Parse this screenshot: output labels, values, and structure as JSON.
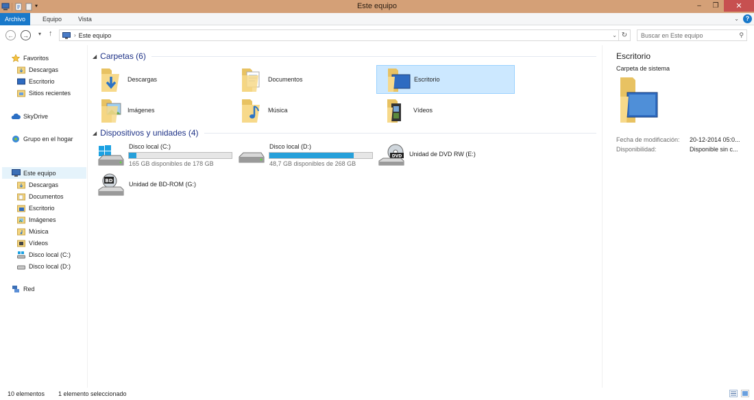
{
  "window": {
    "title": "Este equipo",
    "controls": {
      "minimize": "–",
      "maximize": "❐",
      "close": "✕"
    }
  },
  "ribbon": {
    "tabs": [
      {
        "label": "Archivo"
      },
      {
        "label": "Equipo"
      },
      {
        "label": "Vista"
      }
    ],
    "help_label": "?"
  },
  "address_bar": {
    "back_icon": "back-arrow-icon",
    "forward_icon": "forward-arrow-icon",
    "up_icon": "up-arrow-icon",
    "breadcrumb": [
      "Este equipo"
    ]
  },
  "search": {
    "placeholder": "Buscar en Este equipo",
    "value": ""
  },
  "nav_pane": {
    "favorites": {
      "label": "Favoritos",
      "items": [
        {
          "label": "Descargas",
          "icon": "downloads-folder-icon"
        },
        {
          "label": "Escritorio",
          "icon": "desktop-icon"
        },
        {
          "label": "Sitios recientes",
          "icon": "recent-places-icon"
        }
      ]
    },
    "skydrive": {
      "label": "SkyDrive"
    },
    "homegroup": {
      "label": "Grupo en el hogar"
    },
    "this_pc": {
      "label": "Este equipo",
      "items": [
        {
          "label": "Descargas"
        },
        {
          "label": "Documentos"
        },
        {
          "label": "Escritorio"
        },
        {
          "label": "Imágenes"
        },
        {
          "label": "Música"
        },
        {
          "label": "Vídeos"
        },
        {
          "label": "Disco local (C:)"
        },
        {
          "label": "Disco local (D:)"
        }
      ]
    },
    "network": {
      "label": "Red"
    }
  },
  "content": {
    "folders_group": {
      "title": "Carpetas (6)",
      "items": [
        {
          "label": "Descargas",
          "icon": "downloads-folder-icon"
        },
        {
          "label": "Documentos",
          "icon": "documents-folder-icon"
        },
        {
          "label": "Escritorio",
          "icon": "desktop-folder-icon",
          "selected": true
        },
        {
          "label": "Imágenes",
          "icon": "pictures-folder-icon"
        },
        {
          "label": "Música",
          "icon": "music-folder-icon"
        },
        {
          "label": "Vídeos",
          "icon": "videos-folder-icon"
        }
      ]
    },
    "devices_group": {
      "title": "Dispositivos y unidades (4)",
      "drives": [
        {
          "label": "Disco local (C:)",
          "free_text": "165 GB disponibles de 178 GB",
          "used_fraction": 0.073,
          "icon": "windows-drive-icon"
        },
        {
          "label": "Disco local (D:)",
          "free_text": "48,7 GB disponibles de 268 GB",
          "used_fraction": 0.818,
          "icon": "hard-drive-icon"
        }
      ],
      "optical": [
        {
          "label": "Unidad de DVD RW (E:)",
          "icon": "dvd-drive-icon",
          "badge": "DVD"
        },
        {
          "label": "Unidad de BD-ROM (G:)",
          "icon": "bd-drive-icon",
          "badge": "BD"
        }
      ]
    }
  },
  "details": {
    "name": "Escritorio",
    "type": "Carpeta de sistema",
    "properties": [
      {
        "key": "Fecha de modificación:",
        "value": "20-12-2014 05:0..."
      },
      {
        "key": "Disponibilidad:",
        "value": "Disponible sin c..."
      }
    ]
  },
  "status": {
    "count": "10 elementos",
    "selection": "1 elemento seleccionado"
  },
  "colors": {
    "titlebar": "#d4a077",
    "accent": "#1979ca",
    "selection": "#cce8ff",
    "drive_bar": "#26a0da",
    "group_title": "#1e3287"
  }
}
